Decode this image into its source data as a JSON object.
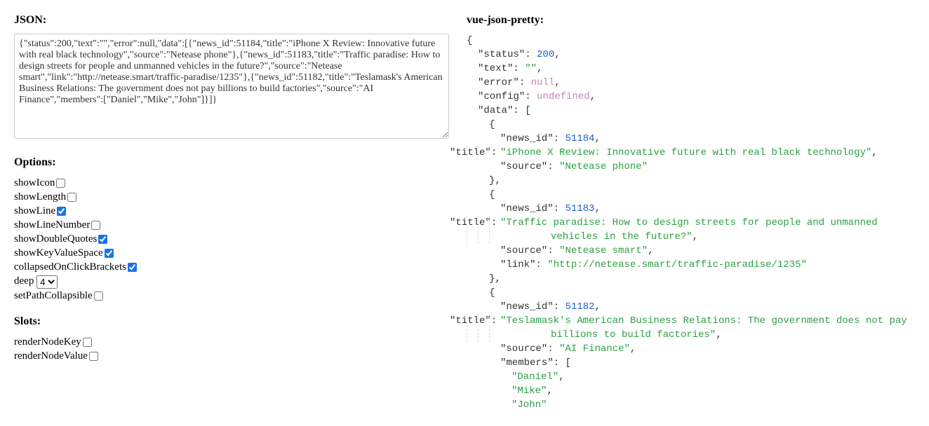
{
  "left": {
    "jsonTitle": "JSON:",
    "textareaValue": "{\"status\":200,\"text\":\"\",\"error\":null,\"data\":[{\"news_id\":51184,\"title\":\"iPhone X Review: Innovative future with real black technology\",\"source\":\"Netease phone\"},{\"news_id\":51183,\"title\":\"Traffic paradise: How to design streets for people and unmanned vehicles in the future?\",\"source\":\"Netease smart\",\"link\":\"http://netease.smart/traffic-paradise/1235\"},{\"news_id\":51182,\"title\":\"Teslamask's American Business Relations: The government does not pay billions to build factories\",\"source\":\"AI Finance\",\"members\":[\"Daniel\",\"Mike\",\"John\"]}]}",
    "optionsTitle": "Options:",
    "options": {
      "showIcon": {
        "label": "showIcon",
        "checked": false
      },
      "showLength": {
        "label": "showLength",
        "checked": false
      },
      "showLine": {
        "label": "showLine",
        "checked": true
      },
      "showLineNumber": {
        "label": "showLineNumber",
        "checked": false
      },
      "showDoubleQuotes": {
        "label": "showDoubleQuotes",
        "checked": true
      },
      "showKeyValueSpace": {
        "label": "showKeyValueSpace",
        "checked": true
      },
      "collapsedOnClickBrackets": {
        "label": "collapsedOnClickBrackets",
        "checked": true
      },
      "deep": {
        "label": "deep",
        "value": "4"
      },
      "setPathCollapsible": {
        "label": "setPathCollapsible",
        "checked": false
      }
    },
    "slotsTitle": "Slots:",
    "slots": {
      "renderNodeKey": {
        "label": "renderNodeKey",
        "checked": false
      },
      "renderNodeValue": {
        "label": "renderNodeValue",
        "checked": false
      }
    }
  },
  "right": {
    "title": "vue-json-pretty:",
    "json": {
      "status": 200,
      "text": "",
      "error_key": "error",
      "error_val": "null",
      "config_key": "config",
      "config_val": "undefined",
      "data": [
        {
          "news_id": 51184,
          "title": "iPhone X Review: Innovative future with real black technology",
          "source": "Netease phone"
        },
        {
          "news_id": 51183,
          "title": "Traffic paradise: How to design streets for people and unmanned vehicles in the future?",
          "source": "Netease smart",
          "link": "http://netease.smart/traffic-paradise/1235"
        },
        {
          "news_id": 51182,
          "title": "Teslamask's American Business Relations: The government does not pay billions to build factories",
          "source": "AI Finance",
          "members": [
            "Daniel",
            "Mike",
            "John"
          ]
        }
      ]
    }
  }
}
